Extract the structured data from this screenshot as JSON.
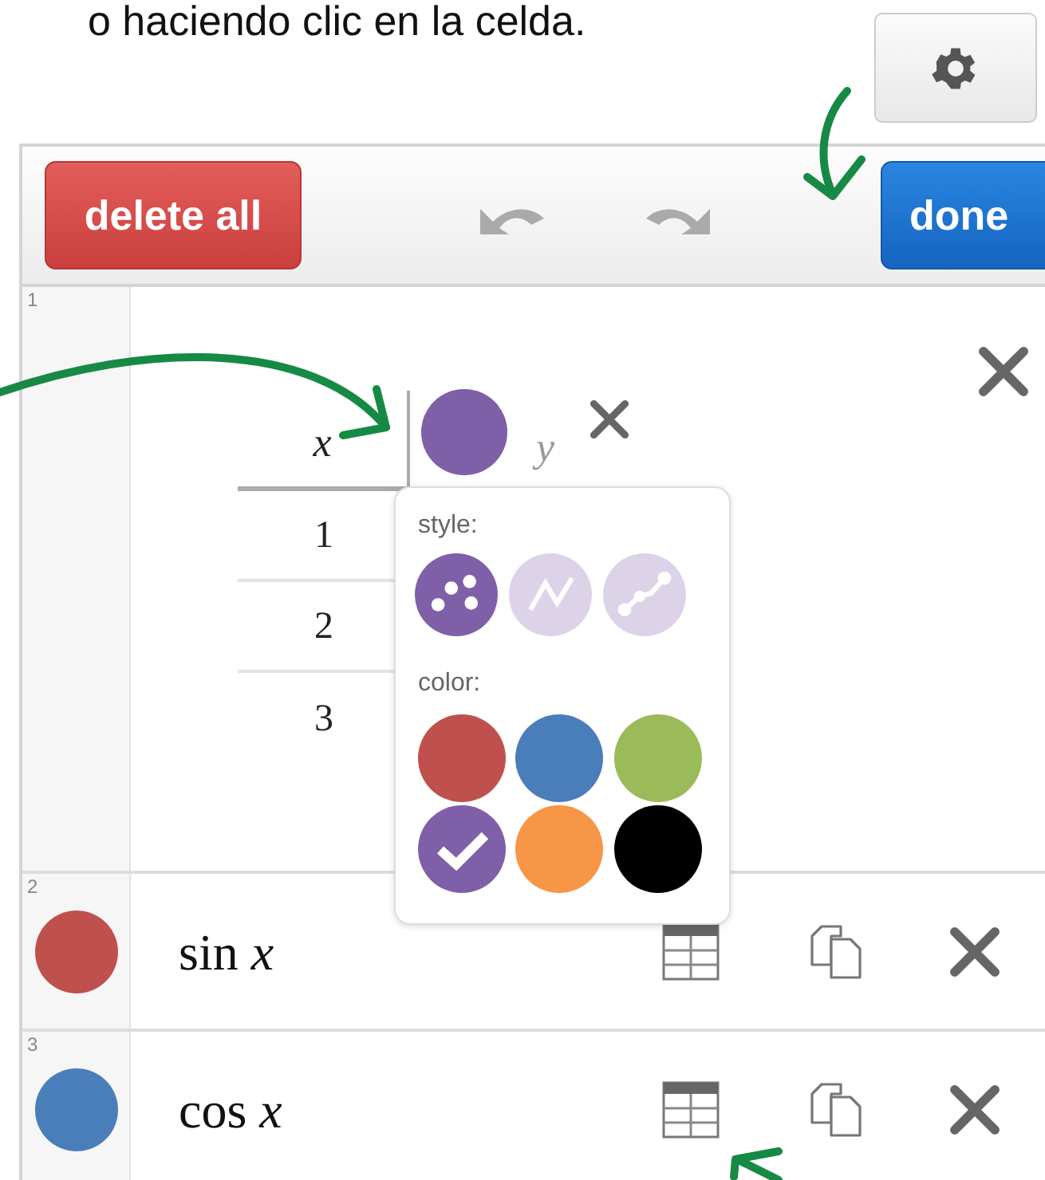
{
  "caption": "o haciendo clic en la celda.",
  "toolbar": {
    "delete_all": "delete all",
    "done": "done"
  },
  "expressions": [
    {
      "number": "1",
      "kind": "table",
      "header_x": "x",
      "header_y": "y",
      "color": "#7f5fa8",
      "rows": [
        "1",
        "2",
        "3"
      ]
    },
    {
      "number": "2",
      "kind": "formula",
      "color": "#c0504d",
      "text": "sin *x*"
    },
    {
      "number": "3",
      "kind": "formula",
      "color": "#4a7ebb",
      "text": "cos *x*"
    }
  ],
  "popover": {
    "style_label": "style:",
    "styles": [
      {
        "kind": "points",
        "selected": true
      },
      {
        "kind": "lines",
        "selected": false
      },
      {
        "kind": "points_lines",
        "selected": false
      }
    ],
    "color_label": "color:",
    "colors": [
      {
        "color": "#c0504d",
        "selected": false
      },
      {
        "color": "#4a7ebb",
        "selected": false
      },
      {
        "color": "#9bbb59",
        "selected": false
      },
      {
        "color": "#7f5fa8",
        "selected": true
      },
      {
        "color": "#f79646",
        "selected": false
      },
      {
        "color": "#000000",
        "selected": false
      }
    ]
  }
}
